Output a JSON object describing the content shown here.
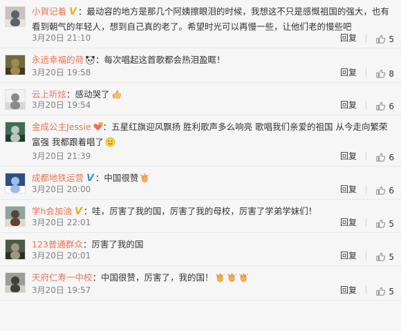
{
  "ui": {
    "reply_label": "回复"
  },
  "comments": [
    {
      "user": "小賀记着",
      "badge": "gold",
      "text": "：最动容的地方是那几个阿姨擦眼泪的时候，我想这不只是感慨祖国的强大，也有看到朝气的年轻人，想到自己真的老了。希望时光可以再慢一些，让他们老的慢些吧",
      "time": "3月20日 21:10",
      "likes": "5"
    },
    {
      "user": "永远幸福的荷",
      "badge": "panda",
      "text": "：每次唱起这首歌都会热泪盈眶！",
      "time": "3月20日 19:58",
      "likes": "8"
    },
    {
      "user": "云上听炫",
      "badge": "",
      "text": "：感动哭了",
      "time": "3月20日 19:54",
      "likes": "6",
      "emojis": [
        "thumbs-up-emoji"
      ]
    },
    {
      "user": "金成公主Jessie",
      "badge": "heart",
      "text": "：五星红旗迎风飘扬 胜利歌声多么响亮 歌唱我们亲爱的祖国 从今走向繁荣富强 我都跟着唱了",
      "time": "3月20日 21:39",
      "likes": "6",
      "emojis": [
        "smile-emoji"
      ]
    },
    {
      "user": "成都地铁运营",
      "badge": "blue",
      "text": "：中国很赞",
      "time": "3月20日 20:00",
      "likes": "6",
      "emojis": [
        "clap-emoji"
      ]
    },
    {
      "user": "学h会加油",
      "badge": "gold",
      "text": "：哇，厉害了我的国，厉害了我的母校，厉害了学弟学妹们！",
      "time": "3月20日 22:01",
      "likes": "5"
    },
    {
      "user": "123普通群众",
      "badge": "",
      "text": "：厉害了我的国",
      "time": "3月20日 20:01",
      "likes": "5"
    },
    {
      "user": "天府仁寿一中校",
      "badge": "",
      "text": "：中国很赞，厉害了，我的国！",
      "time": "3月20日 19:57",
      "likes": "5",
      "emojis": [
        "clap-emoji",
        "clap-emoji",
        "clap-emoji"
      ]
    }
  ]
}
